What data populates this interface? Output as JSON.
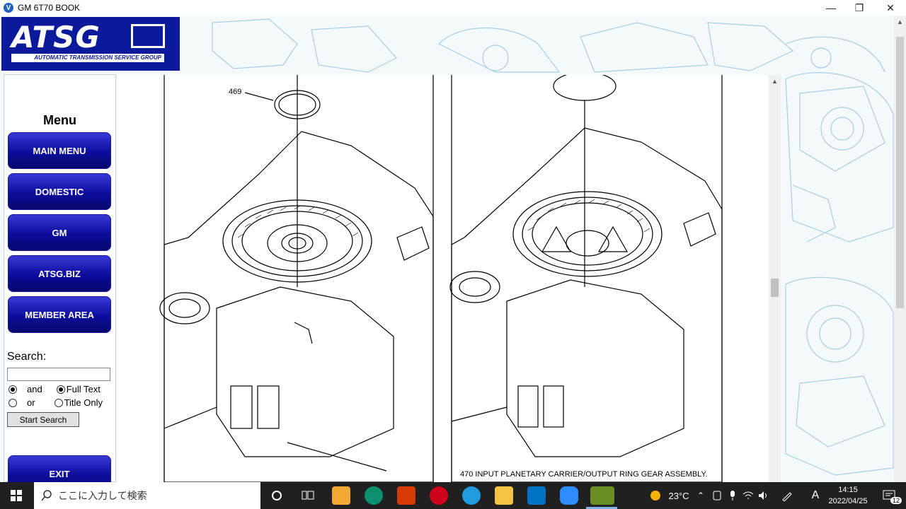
{
  "window": {
    "title": "GM 6T70 BOOK",
    "app_icon": "V"
  },
  "logo": {
    "text": "ATSG",
    "tagline": "AUTOMATIC TRANSMISSION SERVICE GROUP"
  },
  "menu": {
    "title": "Menu",
    "buttons": [
      "MAIN MENU",
      "DOMESTIC",
      "GM",
      "ATSG.BIZ",
      "MEMBER AREA"
    ],
    "exit_label": "EXIT"
  },
  "search": {
    "label": "Search:",
    "value": "",
    "opt_and": "and",
    "opt_or": "or",
    "opt_fulltext": "Full Text",
    "opt_titleonly": "Title Only",
    "button": "Start Search"
  },
  "document": {
    "left_callout": "469",
    "caption": "470  INPUT PLANETARY CARRIER/OUTPUT RING GEAR ASSEMBLY."
  },
  "taskbar": {
    "search_placeholder": "ここに入力して検索",
    "weather": "23°C",
    "ime": "A",
    "time": "14:15",
    "date": "2022/04/25",
    "notifications": "12"
  },
  "colors": {
    "brand": "#0b1a9a",
    "button_top": "#3a3ad8",
    "button_bottom": "#07076a",
    "blueprint": "#a7cfe6"
  }
}
